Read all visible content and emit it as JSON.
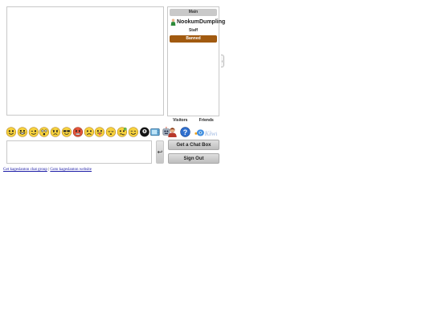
{
  "user_panel": {
    "main_label": "Main",
    "online_user": "NookumDumpling",
    "staff_label": "Staff",
    "banned_label": "Banned"
  },
  "tabs": {
    "visitors": "Visitors",
    "friends": "Friends"
  },
  "emoticons": [
    "smile",
    "grin",
    "wink",
    "surprised",
    "angry",
    "cool",
    "mad",
    "sad",
    "tongue",
    "sleepy",
    "confused",
    "happy",
    "eight-ball",
    "tv",
    "robot"
  ],
  "extra_icons": [
    "user-icon",
    "help-icon",
    "kiwi-logo"
  ],
  "composer": {
    "message_value": "",
    "send_glyph": "↩"
  },
  "buttons": {
    "get_chat_box": "Get a Chat Box",
    "sign_out": "Sign Out"
  },
  "footer": {
    "link_get": "Get kageslanton chat group",
    "separator": " | ",
    "link_goto": "Goto kageslanton website"
  },
  "colors": {
    "banned": "#a15a10",
    "main_bar": "#c9c9c9",
    "link": "#1a1aa6",
    "emoji_yellow": "#f7d23e"
  }
}
